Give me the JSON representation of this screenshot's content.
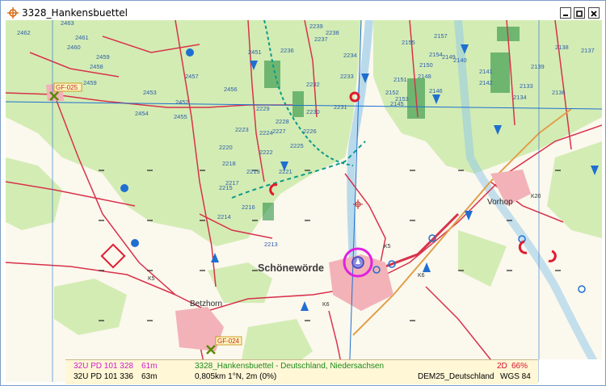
{
  "window": {
    "title": "3328_Hankensbuettel"
  },
  "map": {
    "place_names": {
      "main": "Schönewörde",
      "vorhop": "Vorhop",
      "betzhorn": "Betzhorn"
    },
    "waypoints": [
      "GF-025",
      "GF-024"
    ],
    "road_labels": [
      "K5",
      "K6",
      "K5",
      "K20",
      "K6"
    ],
    "grid_numbers": [
      "2463",
      "2462",
      "2459",
      "2461",
      "2460",
      "2457",
      "2458",
      "2459",
      "2456",
      "2453",
      "2455",
      "2454",
      "2452",
      "2451",
      "2239",
      "2236",
      "2237",
      "2238",
      "2234",
      "2233",
      "2232",
      "2231",
      "2230",
      "2229",
      "2228",
      "2227",
      "2226",
      "2225",
      "2224",
      "2223",
      "2222",
      "2221",
      "2220",
      "2219",
      "2218",
      "2217",
      "2216",
      "2215",
      "2214",
      "2213",
      "2157",
      "2154",
      "2155",
      "2151",
      "2152",
      "2153",
      "2150",
      "2149",
      "2148",
      "2146",
      "2145",
      "2140",
      "2139",
      "2141",
      "2142",
      "2138",
      "2137",
      "2136",
      "2133",
      "2134"
    ]
  },
  "status": {
    "coord_cursor": "32U PD 101 328",
    "elev_cursor": "61m",
    "coord_pos": "32U PD 101 336",
    "elev_pos": "63m",
    "map_name": "3328_Hankensbuettel - Deutschland, Niedersachsen",
    "distance": "0,805km 1°N,  2m (0%)",
    "fix_mode": "2D",
    "fix_pct": "66%",
    "dem": "DEM25_Deutschland",
    "datum": "WGS 84"
  },
  "colors": {
    "forest": "#d3ecb4",
    "road": "#d8324a",
    "grid_blue": "#1f6fd0",
    "text_blue": "#2e5fa8",
    "magenta": "#e020e0",
    "status_bg": "#fff7d6",
    "green_text": "#1a8a1a",
    "red_text": "#d8102a"
  }
}
